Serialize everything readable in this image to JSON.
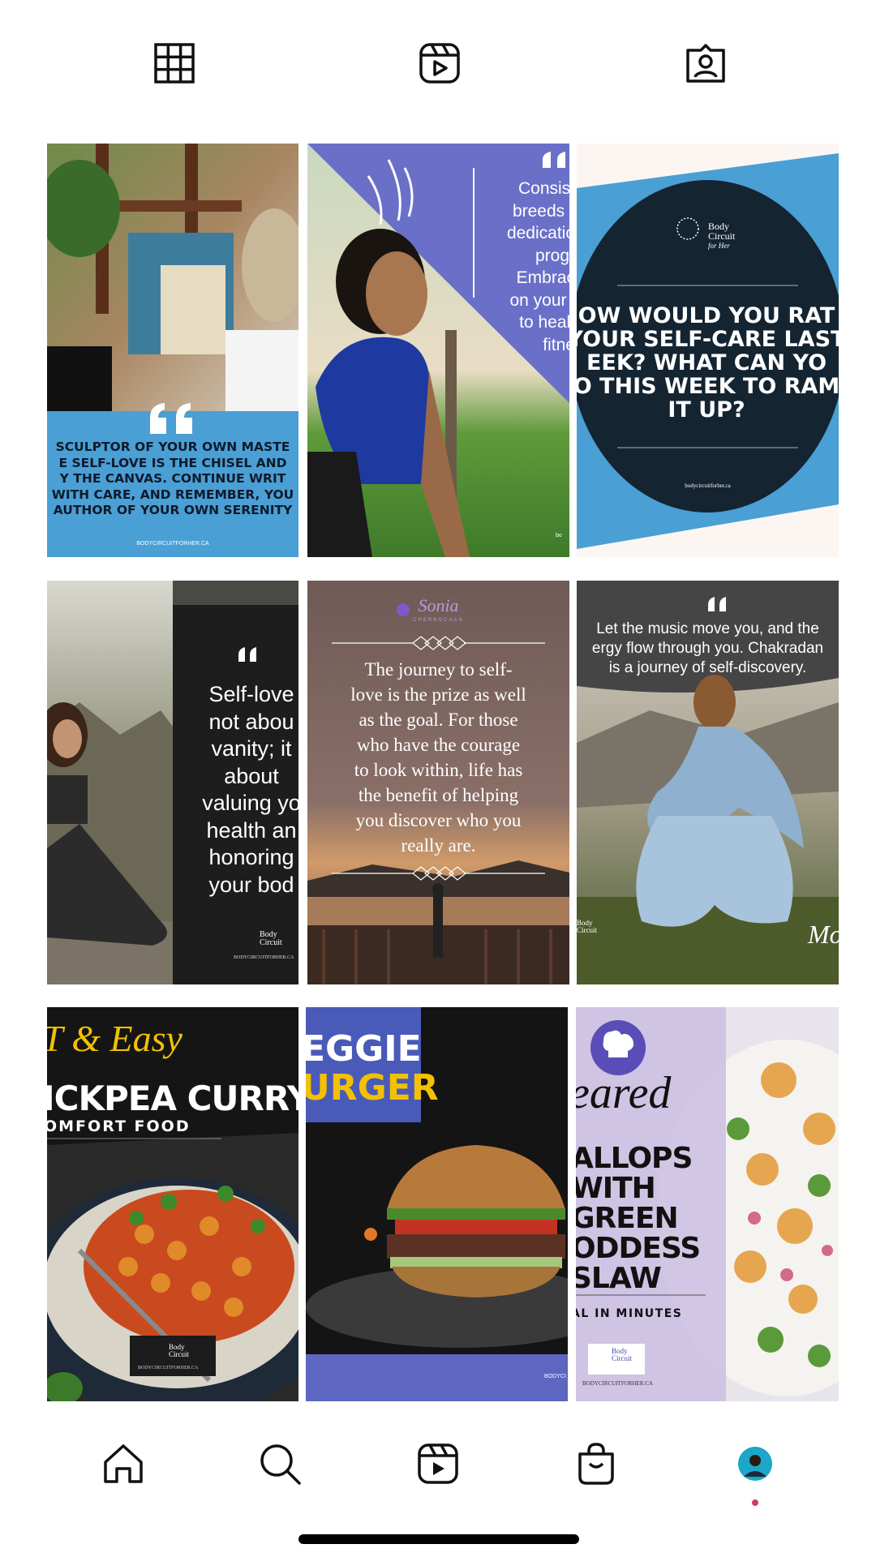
{
  "profile_tabs": [
    {
      "name": "grid-icon",
      "active": true
    },
    {
      "name": "reels-icon",
      "active": false
    },
    {
      "name": "tagged-icon",
      "active": false
    }
  ],
  "posts": {
    "p1": {
      "text": "SCULPTOR OF YOUR OWN MASTE\nE SELF-LOVE IS THE CHISEL AND\nY THE CANVAS. CONTINUE WRIT\nWITH CARE, AND REMEMBER, YOU\nAUTHOR OF YOUR OWN SERENITY",
      "site": "BODYCIRCUITFORHER.CA"
    },
    "p2": {
      "text": "Consist\nbreeds r\ndedicatio\nprogr\nEmbrac\non your j\nto healt\nfitne",
      "site": "bo"
    },
    "p3": {
      "brand_line1": "Body",
      "brand_line2": "Circuit",
      "brand_line3": "for Her",
      "text": "OW WOULD YOU RAT\nYOUR SELF-CARE LAST\nEEK? WHAT CAN YO\nO THIS WEEK TO RAM\nIT UP?",
      "site": "bodycircuitforher.ca"
    },
    "p4": {
      "text": "Self-love\nnot abou\nvanity; it\nabout\nvaluing yo\nhealth an\nhonoring\nyour bod",
      "brand_line1": "Body",
      "brand_line2": "Circuit",
      "site": "BODYCIRCUITFORHER.CA"
    },
    "p5": {
      "brand": "Sonia",
      "brand_sub": "CHERNOCAAN",
      "text": "The journey to self-\nlove is the prize as well\nas the goal. For those\nwho have the courage\nto look within, life has\nthe benefit of helping\nyou discover who you\nreally are."
    },
    "p6": {
      "text": "Let the music move you, and the\nergy flow through you. Chakradan\nis a journey of self-discovery.",
      "brand_line1": "Body",
      "brand_line2": "Circuit",
      "signature": "Mot"
    },
    "p7": {
      "script": "T & Easy",
      "title": "ICKPEA CURRY",
      "subtitle": "OMFORT FOOD",
      "brand_line1": "Body",
      "brand_line2": "Circuit",
      "site": "BODYCIRCUITFORHER.CA"
    },
    "p8": {
      "line1": "EGGIE",
      "line2": "URGER",
      "site": "BODYCI"
    },
    "p9": {
      "script": "eared",
      "title": "ALLOPS\nWITH\nGREEN\nODDESS\nSLAW",
      "subtitle": "AL IN MINUTES",
      "brand_line1": "Body",
      "brand_line2": "Circuit",
      "site": "BODYCIRCUITFORHER.CA"
    }
  },
  "bottom_nav": [
    {
      "name": "home-icon"
    },
    {
      "name": "search-icon"
    },
    {
      "name": "reels-nav-icon"
    },
    {
      "name": "shop-icon"
    },
    {
      "name": "profile-avatar"
    }
  ],
  "colors": {
    "notification_dot": "#d23a5a",
    "accent_blue": "#4a9fd4",
    "accent_purple": "#6a70c8"
  }
}
